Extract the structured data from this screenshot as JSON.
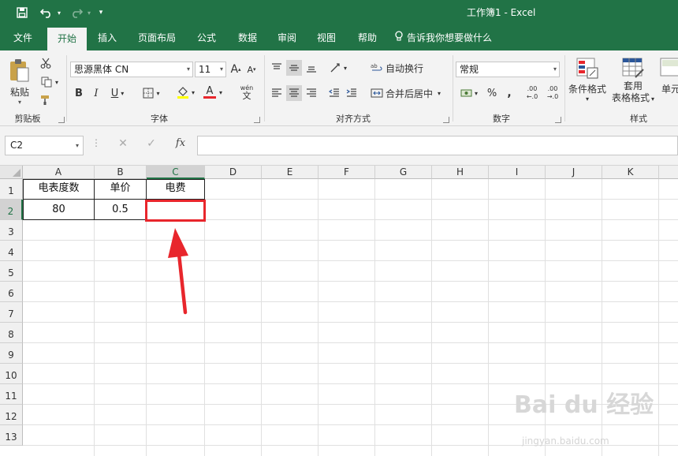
{
  "window": {
    "title": "工作簿1  -  Excel"
  },
  "tabs": [
    {
      "label": "文件"
    },
    {
      "label": "开始",
      "active": true
    },
    {
      "label": "插入"
    },
    {
      "label": "页面布局"
    },
    {
      "label": "公式"
    },
    {
      "label": "数据"
    },
    {
      "label": "审阅"
    },
    {
      "label": "视图"
    },
    {
      "label": "帮助"
    },
    {
      "label": "告诉我你想要做什么"
    }
  ],
  "ribbon": {
    "clipboard": {
      "paste": "粘贴",
      "label": "剪贴板"
    },
    "font": {
      "name": "思源黑体 CN",
      "size": "11",
      "grow": "A",
      "shrink": "A",
      "bold": "B",
      "italic": "I",
      "underline": "U",
      "font_color": "A",
      "phonetic_top": "wén",
      "phonetic_bottom": "文",
      "label": "字体"
    },
    "alignment": {
      "wrap": "自动换行",
      "merge": "合并后居中",
      "label": "对齐方式"
    },
    "number": {
      "format": "常规",
      "percent": "%",
      "comma": ",",
      "inc_decimal_top": ".00",
      "inc_decimal_bottom": "←.0",
      "dec_decimal_top": ".00",
      "dec_decimal_bottom": "→.0",
      "label": "数字"
    },
    "styles": {
      "conditional": "条件格式",
      "table_line1": "套用",
      "table_line2": "表格格式",
      "cell": "单元",
      "label": "样式"
    }
  },
  "formula_bar": {
    "name_box": "C2",
    "cancel": "✕",
    "enter": "✓",
    "fx": "fx",
    "value": ""
  },
  "sheet": {
    "columns": [
      "A",
      "B",
      "C",
      "D",
      "E",
      "F",
      "G",
      "H",
      "I",
      "J",
      "K"
    ],
    "rows": [
      "1",
      "2",
      "3",
      "4",
      "5",
      "6",
      "7",
      "8",
      "9",
      "10",
      "11",
      "12",
      "13"
    ],
    "cells": {
      "A1": "电表度数",
      "B1": "单价",
      "C1": "电费",
      "A2": "80",
      "B2": "0.5",
      "C2": ""
    },
    "selected_cell": "C2",
    "highlight_color": "#e8262c"
  },
  "watermark": {
    "text": "Bai du 经验",
    "url": "jingyan.baidu.com"
  },
  "colors": {
    "brand": "#217346",
    "annotation": "#e8262c"
  }
}
